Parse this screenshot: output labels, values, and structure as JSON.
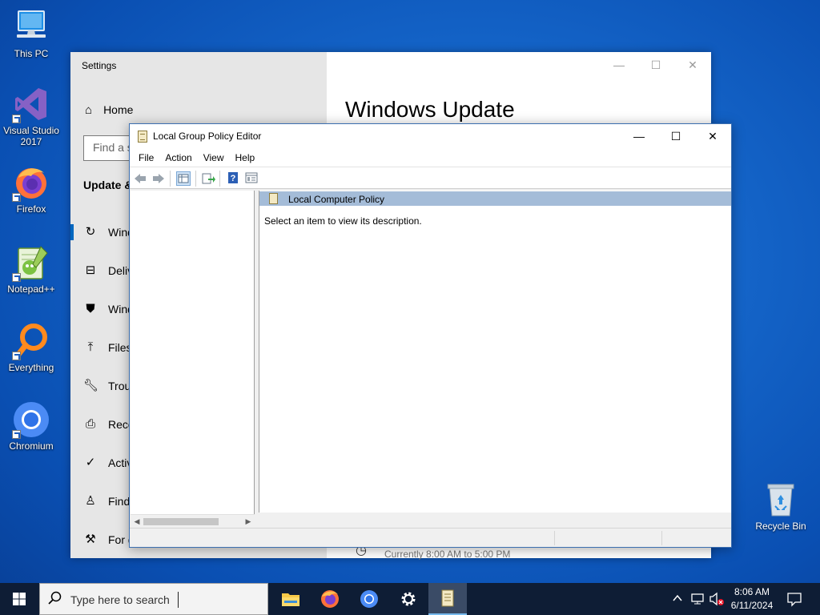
{
  "desktop": {
    "icons": [
      {
        "label": "This PC",
        "icon": "this-pc-icon"
      },
      {
        "label": "Visual Studio 2017",
        "icon": "visual-studio-icon"
      },
      {
        "label": "Firefox",
        "icon": "firefox-icon"
      },
      {
        "label": "Notepad++",
        "icon": "notepadpp-icon"
      },
      {
        "label": "Everything",
        "icon": "everything-icon"
      },
      {
        "label": "Chromium",
        "icon": "chromium-icon"
      }
    ],
    "recycle_bin": {
      "label": "Recycle Bin",
      "icon": "recycle-bin-icon"
    }
  },
  "settings": {
    "app_title": "Settings",
    "home_label": "Home",
    "find_placeholder": "Find a s",
    "section": "Update &",
    "page_title": "Windows Update",
    "nav_items": [
      {
        "label": "Wind",
        "icon": "sync-icon"
      },
      {
        "label": "Deliv",
        "icon": "delivery-icon"
      },
      {
        "label": "Wind",
        "icon": "shield-icon"
      },
      {
        "label": "Files",
        "icon": "upload-icon"
      },
      {
        "label": "Trou",
        "icon": "wrench-icon"
      },
      {
        "label": "Reco",
        "icon": "recovery-icon"
      },
      {
        "label": "Activ",
        "icon": "check-circle-icon"
      },
      {
        "label": "Find",
        "icon": "person-icon"
      },
      {
        "label": "For d",
        "icon": "tools-icon"
      }
    ],
    "bottom_text": "Currently 8:00 AM to 5:00 PM",
    "accent_color": "#0067c0"
  },
  "gpe": {
    "title": "Local Group Policy Editor",
    "menu": [
      "File",
      "Action",
      "View",
      "Help"
    ],
    "toolbar": [
      "back-arrow-icon",
      "forward-arrow-icon",
      "show-hide-tree-icon",
      "export-list-icon",
      "help-icon",
      "properties-icon"
    ],
    "header": "Local Computer Policy",
    "description": "Select an item to view its description.",
    "header_color": "#a4bcd8"
  },
  "taskbar": {
    "search_placeholder": "Type here to search",
    "apps": [
      "file-explorer-icon",
      "firefox-icon",
      "chromium-icon",
      "settings-gear-icon",
      "group-policy-editor-icon"
    ],
    "time": "8:06 AM",
    "date": "6/11/2024",
    "tray_icons": [
      "chevron-up-icon",
      "network-icon",
      "volume-muted-icon",
      "notifications-icon"
    ]
  }
}
